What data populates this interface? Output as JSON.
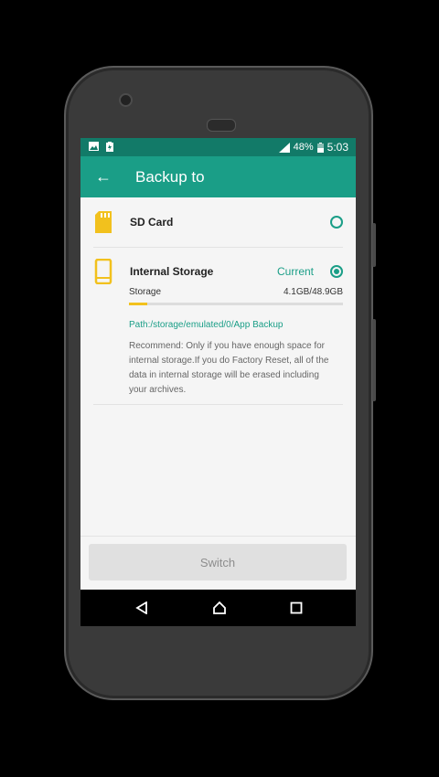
{
  "status": {
    "battery": "48%",
    "time": "5:03"
  },
  "appbar": {
    "title": "Backup to"
  },
  "sd_card": {
    "label": "SD Card"
  },
  "internal": {
    "label": "Internal Storage",
    "current_label": "Current",
    "storage_label": "Storage",
    "storage_value": "4.1GB/48.9GB",
    "used_fraction": 0.084,
    "path": "Path:/storage/emulated/0/App Backup",
    "note": "Recommend: Only if you have enough space for internal storage.If you do Factory Reset, all of the data in internal storage will be erased including your archives."
  },
  "footer": {
    "switch_label": "Switch"
  },
  "colors": {
    "accent": "#1a9e87",
    "statusbar": "#127a68",
    "progress": "#f2c11d"
  }
}
